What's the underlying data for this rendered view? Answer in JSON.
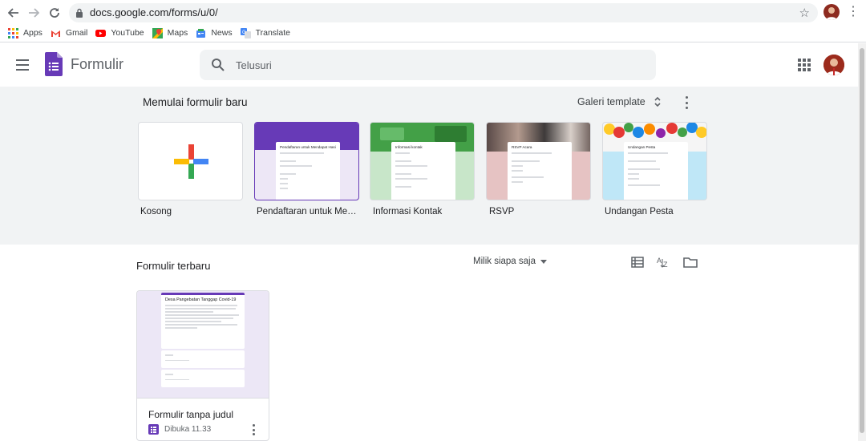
{
  "browser": {
    "url": "docs.google.com/forms/u/0/",
    "bookmarks": [
      {
        "label": "Apps",
        "icon": "apps-grid-icon"
      },
      {
        "label": "Gmail",
        "icon": "gmail-icon"
      },
      {
        "label": "YouTube",
        "icon": "youtube-icon"
      },
      {
        "label": "Maps",
        "icon": "maps-icon"
      },
      {
        "label": "News",
        "icon": "news-icon"
      },
      {
        "label": "Translate",
        "icon": "translate-icon"
      }
    ]
  },
  "header": {
    "app_title": "Formulir",
    "search_placeholder": "Telusuri"
  },
  "templates": {
    "heading": "Memulai formulir baru",
    "gallery_label": "Galeri template",
    "items": [
      {
        "label": "Kosong",
        "mini_title": ""
      },
      {
        "label": "Pendaftaran untuk Mendapat Hasil",
        "mini_title": "Pendaftaran untuk Mendapat Hasil"
      },
      {
        "label": "Informasi Kontak",
        "mini_title": "Informasi kontak"
      },
      {
        "label": "RSVP",
        "mini_title": "RSVP Acara"
      },
      {
        "label": "Undangan Pesta",
        "mini_title": "Undangan Pesta"
      }
    ]
  },
  "recent": {
    "heading": "Formulir terbaru",
    "owner_filter": "Milik siapa saja",
    "docs": [
      {
        "title": "Formulir tanpa judul",
        "meta": "Dibuka 11.33",
        "thumb_title": "Desa Pangebatan Tanggap Covid-19"
      }
    ]
  },
  "colors": {
    "forms_purple": "#673ab7",
    "section_bg": "#f1f3f4"
  }
}
